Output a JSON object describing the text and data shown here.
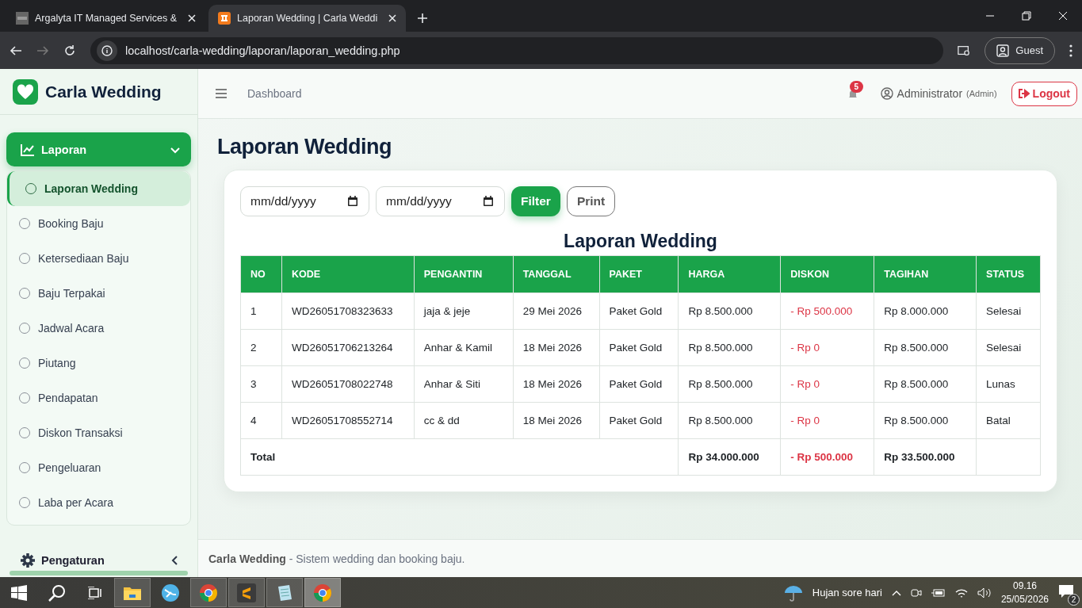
{
  "browser": {
    "tabs": [
      {
        "title": "Argalyta IT Managed Services &",
        "selected": false,
        "kind": "site"
      },
      {
        "title": "Laporan Wedding | Carla Weddi",
        "selected": true,
        "kind": "xampp"
      }
    ],
    "url": "localhost/carla-wedding/laporan/laporan_wedding.php",
    "profile": "Guest"
  },
  "sidebar": {
    "brand": "Carla Wedding",
    "items": [
      {
        "label": "Laporan",
        "kind": "chart",
        "expanded": true,
        "children": [
          {
            "label": "Laporan Wedding",
            "selected": true
          },
          {
            "label": "Booking Baju",
            "selected": false
          },
          {
            "label": "Ketersediaan Baju",
            "selected": false
          },
          {
            "label": "Baju Terpakai",
            "selected": false
          },
          {
            "label": "Jadwal Acara",
            "selected": false
          },
          {
            "label": "Piutang",
            "selected": false
          },
          {
            "label": "Pendapatan",
            "selected": false
          },
          {
            "label": "Diskon Transaksi",
            "selected": false
          },
          {
            "label": "Pengeluaran",
            "selected": false
          },
          {
            "label": "Laba per Acara",
            "selected": false
          }
        ]
      },
      {
        "label": "Pengaturan",
        "kind": "gear",
        "expanded": false
      }
    ]
  },
  "header": {
    "breadcrumb": "Dashboard",
    "notifications": "5",
    "user": "Administrator",
    "role": "(Admin)",
    "logout": "Logout"
  },
  "page": {
    "title": "Laporan Wedding",
    "date_fields": [
      {
        "placeholder": "mm/dd/yyyy"
      },
      {
        "placeholder": "mm/dd/yyyy"
      }
    ],
    "filter_button": "Filter",
    "print_button": "Print"
  },
  "report": {
    "title": "Laporan Wedding",
    "columns": [
      {
        "label": "NO",
        "negative": false
      },
      {
        "label": "KODE",
        "negative": false
      },
      {
        "label": "PENGANTIN",
        "negative": false
      },
      {
        "label": "TANGGAL",
        "negative": false
      },
      {
        "label": "PAKET",
        "negative": false
      },
      {
        "label": "HARGA",
        "negative": false
      },
      {
        "label": "DISKON",
        "negative": true
      },
      {
        "label": "TAGIHAN",
        "negative": false
      },
      {
        "label": "STATUS",
        "negative": false
      }
    ],
    "rows": [
      [
        "1",
        "WD26051708323633",
        "jaja & jeje",
        "29 Mei 2026",
        "Paket Gold",
        "Rp 8.500.000",
        "- Rp 500.000",
        "Rp 8.000.000",
        "Selesai"
      ],
      [
        "2",
        "WD26051706213264",
        "Anhar & Kamil",
        "18 Mei 2026",
        "Paket Gold",
        "Rp 8.500.000",
        "- Rp 0",
        "Rp 8.500.000",
        "Selesai"
      ],
      [
        "3",
        "WD26051708022748",
        "Anhar & Siti",
        "18 Mei 2026",
        "Paket Gold",
        "Rp 8.500.000",
        "- Rp 0",
        "Rp 8.500.000",
        "Lunas"
      ],
      [
        "4",
        "WD26051708552714",
        "cc & dd",
        "18 Mei 2026",
        "Paket Gold",
        "Rp 8.500.000",
        "- Rp 0",
        "Rp 8.500.000",
        "Batal"
      ]
    ],
    "total": {
      "label": "Total",
      "harga": "Rp 34.000.000",
      "diskon": "- Rp 500.000",
      "tagihan": "Rp 33.500.000"
    }
  },
  "footer": {
    "text": "**Carla Wedding** - Sistem wedding dan booking baju."
  },
  "taskbar": {
    "apps": [
      {
        "kind": "folder",
        "running": true
      },
      {
        "kind": "globe",
        "running": false
      },
      {
        "kind": "chrome",
        "running": true
      },
      {
        "kind": "editor",
        "running": true
      },
      {
        "kind": "notepad",
        "running": true
      },
      {
        "kind": "chrome",
        "running": true,
        "selected": true
      }
    ],
    "weather": "Hujan sore hari",
    "time": "09.16",
    "date": "25/05/2026",
    "notifications": "2"
  }
}
